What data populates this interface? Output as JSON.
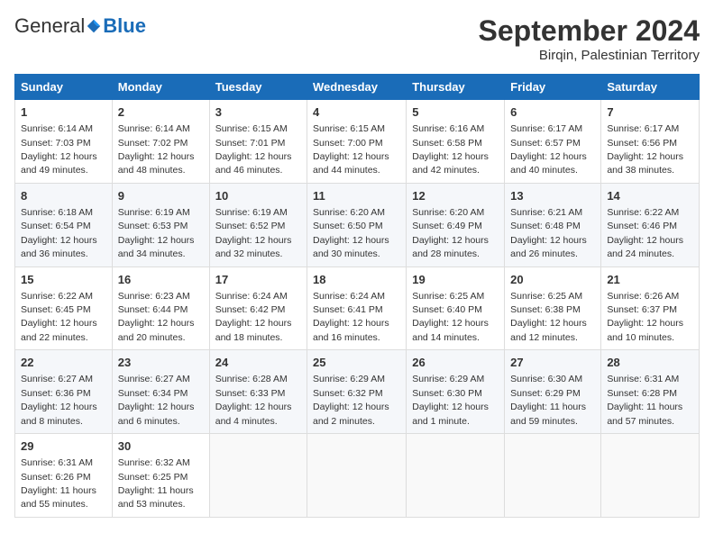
{
  "header": {
    "logo_general": "General",
    "logo_blue": "Blue",
    "month_title": "September 2024",
    "location": "Birqin, Palestinian Territory"
  },
  "weekdays": [
    "Sunday",
    "Monday",
    "Tuesday",
    "Wednesday",
    "Thursday",
    "Friday",
    "Saturday"
  ],
  "weeks": [
    [
      {
        "day": "1",
        "sunrise": "6:14 AM",
        "sunset": "7:03 PM",
        "daylight": "12 hours and 49 minutes."
      },
      {
        "day": "2",
        "sunrise": "6:14 AM",
        "sunset": "7:02 PM",
        "daylight": "12 hours and 48 minutes."
      },
      {
        "day": "3",
        "sunrise": "6:15 AM",
        "sunset": "7:01 PM",
        "daylight": "12 hours and 46 minutes."
      },
      {
        "day": "4",
        "sunrise": "6:15 AM",
        "sunset": "7:00 PM",
        "daylight": "12 hours and 44 minutes."
      },
      {
        "day": "5",
        "sunrise": "6:16 AM",
        "sunset": "6:58 PM",
        "daylight": "12 hours and 42 minutes."
      },
      {
        "day": "6",
        "sunrise": "6:17 AM",
        "sunset": "6:57 PM",
        "daylight": "12 hours and 40 minutes."
      },
      {
        "day": "7",
        "sunrise": "6:17 AM",
        "sunset": "6:56 PM",
        "daylight": "12 hours and 38 minutes."
      }
    ],
    [
      {
        "day": "8",
        "sunrise": "6:18 AM",
        "sunset": "6:54 PM",
        "daylight": "12 hours and 36 minutes."
      },
      {
        "day": "9",
        "sunrise": "6:19 AM",
        "sunset": "6:53 PM",
        "daylight": "12 hours and 34 minutes."
      },
      {
        "day": "10",
        "sunrise": "6:19 AM",
        "sunset": "6:52 PM",
        "daylight": "12 hours and 32 minutes."
      },
      {
        "day": "11",
        "sunrise": "6:20 AM",
        "sunset": "6:50 PM",
        "daylight": "12 hours and 30 minutes."
      },
      {
        "day": "12",
        "sunrise": "6:20 AM",
        "sunset": "6:49 PM",
        "daylight": "12 hours and 28 minutes."
      },
      {
        "day": "13",
        "sunrise": "6:21 AM",
        "sunset": "6:48 PM",
        "daylight": "12 hours and 26 minutes."
      },
      {
        "day": "14",
        "sunrise": "6:22 AM",
        "sunset": "6:46 PM",
        "daylight": "12 hours and 24 minutes."
      }
    ],
    [
      {
        "day": "15",
        "sunrise": "6:22 AM",
        "sunset": "6:45 PM",
        "daylight": "12 hours and 22 minutes."
      },
      {
        "day": "16",
        "sunrise": "6:23 AM",
        "sunset": "6:44 PM",
        "daylight": "12 hours and 20 minutes."
      },
      {
        "day": "17",
        "sunrise": "6:24 AM",
        "sunset": "6:42 PM",
        "daylight": "12 hours and 18 minutes."
      },
      {
        "day": "18",
        "sunrise": "6:24 AM",
        "sunset": "6:41 PM",
        "daylight": "12 hours and 16 minutes."
      },
      {
        "day": "19",
        "sunrise": "6:25 AM",
        "sunset": "6:40 PM",
        "daylight": "12 hours and 14 minutes."
      },
      {
        "day": "20",
        "sunrise": "6:25 AM",
        "sunset": "6:38 PM",
        "daylight": "12 hours and 12 minutes."
      },
      {
        "day": "21",
        "sunrise": "6:26 AM",
        "sunset": "6:37 PM",
        "daylight": "12 hours and 10 minutes."
      }
    ],
    [
      {
        "day": "22",
        "sunrise": "6:27 AM",
        "sunset": "6:36 PM",
        "daylight": "12 hours and 8 minutes."
      },
      {
        "day": "23",
        "sunrise": "6:27 AM",
        "sunset": "6:34 PM",
        "daylight": "12 hours and 6 minutes."
      },
      {
        "day": "24",
        "sunrise": "6:28 AM",
        "sunset": "6:33 PM",
        "daylight": "12 hours and 4 minutes."
      },
      {
        "day": "25",
        "sunrise": "6:29 AM",
        "sunset": "6:32 PM",
        "daylight": "12 hours and 2 minutes."
      },
      {
        "day": "26",
        "sunrise": "6:29 AM",
        "sunset": "6:30 PM",
        "daylight": "12 hours and 1 minute."
      },
      {
        "day": "27",
        "sunrise": "6:30 AM",
        "sunset": "6:29 PM",
        "daylight": "11 hours and 59 minutes."
      },
      {
        "day": "28",
        "sunrise": "6:31 AM",
        "sunset": "6:28 PM",
        "daylight": "11 hours and 57 minutes."
      }
    ],
    [
      {
        "day": "29",
        "sunrise": "6:31 AM",
        "sunset": "6:26 PM",
        "daylight": "11 hours and 55 minutes."
      },
      {
        "day": "30",
        "sunrise": "6:32 AM",
        "sunset": "6:25 PM",
        "daylight": "11 hours and 53 minutes."
      },
      null,
      null,
      null,
      null,
      null
    ]
  ]
}
